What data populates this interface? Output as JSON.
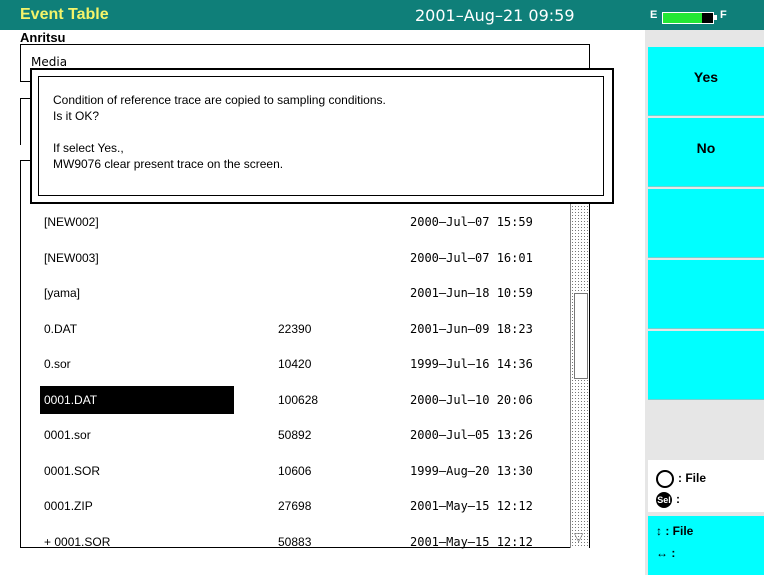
{
  "titlebar": {
    "title": "Event Table",
    "datetime": "2001–Aug–21 09:59",
    "battery": {
      "empty": "E",
      "full": "F",
      "level": 0.78
    }
  },
  "brand": "Anritsu",
  "media_box": {
    "label": "Media"
  },
  "dialog": {
    "line1": "Condition of reference trace are copied to sampling conditions.",
    "line2": "Is it OK?",
    "line3": "If select Yes.,",
    "line4": "MW9076 clear present trace on the screen."
  },
  "files": [
    {
      "name": "[NEW002]",
      "size": "",
      "date": "2000–Jul–07 15:59"
    },
    {
      "name": "[NEW003]",
      "size": "",
      "date": "2000–Jul–07 16:01"
    },
    {
      "name": "[yama]",
      "size": "",
      "date": "2001–Jun–18 10:59"
    },
    {
      "name": "0.DAT",
      "size": "22390",
      "date": "2001–Jun–09 18:23"
    },
    {
      "name": "0.sor",
      "size": "10420",
      "date": "1999–Jul–16 14:36"
    },
    {
      "name": "0001.DAT",
      "size": "100628",
      "date": "2000–Jul–10 20:06",
      "selected": true
    },
    {
      "name": "0001.sor",
      "size": "50892",
      "date": "2000–Jul–05 13:26"
    },
    {
      "name": "0001.SOR",
      "size": "10606",
      "date": "1999–Aug–20 13:30"
    },
    {
      "name": "0001.ZIP",
      "size": "27698",
      "date": "2001–May–15 12:12"
    },
    {
      "name": "+ 0001.SOR",
      "size": "50883",
      "date": "2001–May–15 12:12"
    }
  ],
  "side_buttons": {
    "yes": "Yes",
    "no": "No"
  },
  "legend": {
    "knob_label": "File",
    "sel_label": "",
    "updown_label": "File",
    "leftright_label": ""
  },
  "colors": {
    "title_bg": "#0f7f79",
    "title_text": "#f4f46a",
    "button_bg": "#00ffff",
    "battery_fill": "#23e834"
  }
}
